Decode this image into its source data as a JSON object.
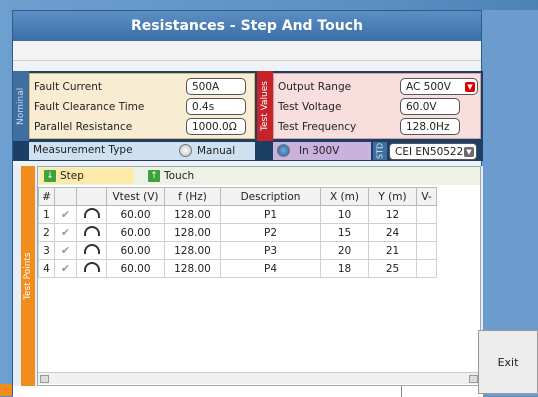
{
  "window": {
    "title": "Resistances - Step And Touch"
  },
  "nominal": {
    "section_label": "Nominal",
    "fault_current": {
      "label": "Fault Current",
      "value": "500A"
    },
    "fault_clearance_time": {
      "label": "Fault Clearance Time",
      "value": "0.4s"
    },
    "parallel_resistance": {
      "label": "Parallel Resistance",
      "value": "1000.0Ω"
    }
  },
  "test_values": {
    "section_label": "Test Values",
    "output_range": {
      "label": "Output Range",
      "value": "AC 500V"
    },
    "test_voltage": {
      "label": "Test Voltage",
      "value": "60.0V"
    },
    "test_frequency": {
      "label": "Test Frequency",
      "value": "128.0Hz"
    }
  },
  "measurement": {
    "label": "Measurement Type",
    "manual_label": "Manual",
    "in300_label": "In 300V",
    "selected": "In 300V",
    "std_label": "STD",
    "standard_value": "CEI EN50522"
  },
  "test_points": {
    "section_label": "Test Points",
    "tab_step": "Step",
    "tab_touch": "Touch",
    "columns": [
      "#",
      "",
      "",
      "Vtest (V)",
      "f (Hz)",
      "Description",
      "X (m)",
      "Y (m)",
      "V-"
    ],
    "rows": [
      {
        "n": "1",
        "vtest": "60.00",
        "f": "128.00",
        "desc": "P1",
        "x": "10",
        "y": "12"
      },
      {
        "n": "2",
        "vtest": "60.00",
        "f": "128.00",
        "desc": "P2",
        "x": "15",
        "y": "24"
      },
      {
        "n": "3",
        "vtest": "60.00",
        "f": "128.00",
        "desc": "P3",
        "x": "20",
        "y": "21"
      },
      {
        "n": "4",
        "vtest": "60.00",
        "f": "128.00",
        "desc": "P4",
        "x": "18",
        "y": "25"
      }
    ]
  },
  "buttons": {
    "exit": "Exit"
  },
  "colors": {
    "accent": "#c8232a",
    "orange": "#f28c1c",
    "blue": "#1c3f66"
  }
}
